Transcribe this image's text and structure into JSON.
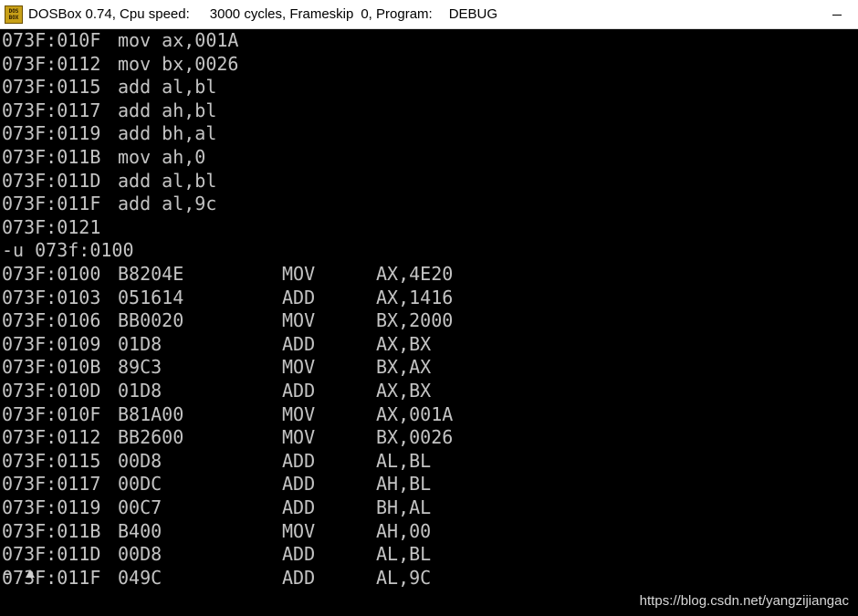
{
  "window": {
    "app_name": "DOSBox 0.74, Cpu speed:",
    "cpu_cycles": "3000 cycles, Frameskip",
    "frameskip": "0, Program:",
    "program": "DEBUG",
    "icon_top": "DOS",
    "icon_bottom": "BOX"
  },
  "assembly_input": [
    {
      "addr": "073F:010F",
      "code": "mov ax,001A"
    },
    {
      "addr": "073F:0112",
      "code": "mov bx,0026"
    },
    {
      "addr": "073F:0115",
      "code": "add al,bl"
    },
    {
      "addr": "073F:0117",
      "code": "add ah,bl"
    },
    {
      "addr": "073F:0119",
      "code": "add bh,al"
    },
    {
      "addr": "073F:011B",
      "code": "mov ah,0"
    },
    {
      "addr": "073F:011D",
      "code": "add al,bl"
    },
    {
      "addr": "073F:011F",
      "code": "add al,9c"
    },
    {
      "addr": "073F:0121",
      "code": ""
    }
  ],
  "command": "-u 073f:0100",
  "disassembly": [
    {
      "addr": "073F:0100",
      "hex": "B8204E",
      "mnemonic": "MOV",
      "operands": "AX,4E20"
    },
    {
      "addr": "073F:0103",
      "hex": "051614",
      "mnemonic": "ADD",
      "operands": "AX,1416"
    },
    {
      "addr": "073F:0106",
      "hex": "BB0020",
      "mnemonic": "MOV",
      "operands": "BX,2000"
    },
    {
      "addr": "073F:0109",
      "hex": "01D8",
      "mnemonic": "ADD",
      "operands": "AX,BX"
    },
    {
      "addr": "073F:010B",
      "hex": "89C3",
      "mnemonic": "MOV",
      "operands": "BX,AX"
    },
    {
      "addr": "073F:010D",
      "hex": "01D8",
      "mnemonic": "ADD",
      "operands": "AX,BX"
    },
    {
      "addr": "073F:010F",
      "hex": "B81A00",
      "mnemonic": "MOV",
      "operands": "AX,001A"
    },
    {
      "addr": "073F:0112",
      "hex": "BB2600",
      "mnemonic": "MOV",
      "operands": "BX,0026"
    },
    {
      "addr": "073F:0115",
      "hex": "00D8",
      "mnemonic": "ADD",
      "operands": "AL,BL"
    },
    {
      "addr": "073F:0117",
      "hex": "00DC",
      "mnemonic": "ADD",
      "operands": "AH,BL"
    },
    {
      "addr": "073F:0119",
      "hex": "00C7",
      "mnemonic": "ADD",
      "operands": "BH,AL"
    },
    {
      "addr": "073F:011B",
      "hex": "B400",
      "mnemonic": "MOV",
      "operands": "AH,00"
    },
    {
      "addr": "073F:011D",
      "hex": "00D8",
      "mnemonic": "ADD",
      "operands": "AL,BL"
    },
    {
      "addr": "073F:011F",
      "hex": "049C",
      "mnemonic": "ADD",
      "operands": "AL,9C"
    }
  ],
  "prompt": "-",
  "watermark": "https://blog.csdn.net/yangzijiangac",
  "colors": {
    "terminal_bg": "#000000",
    "terminal_text": "#c4c4c4",
    "titlebar_bg": "#ffffff"
  },
  "icons": {
    "app": "dosbox-icon",
    "minimize": "minimize-icon",
    "cursor": "mouse-pointer-icon"
  }
}
